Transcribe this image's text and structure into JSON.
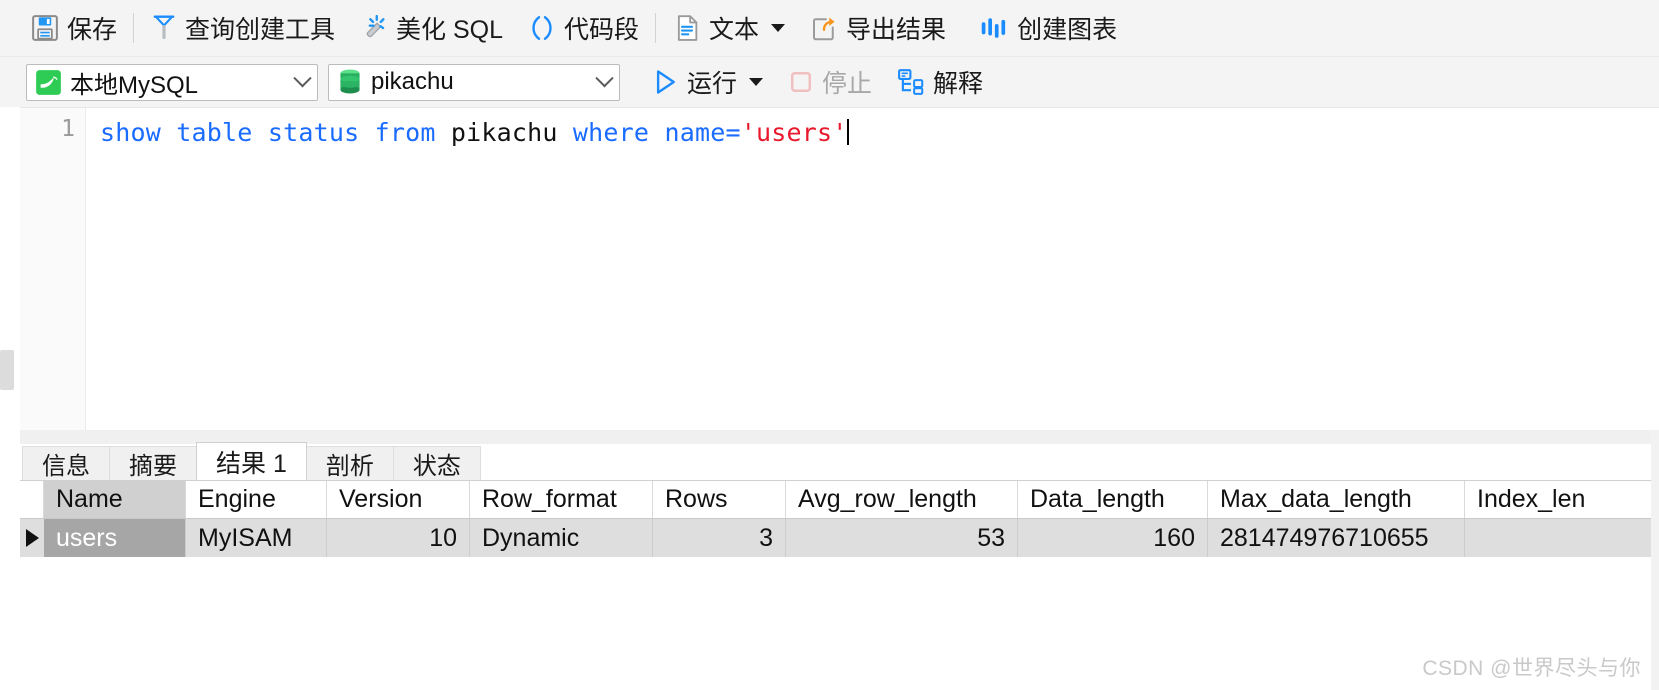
{
  "toolbar_main": {
    "buttons": [
      {
        "id": "save",
        "label": "保存",
        "icon": "floppy-disk-icon",
        "has_caret": false,
        "disabled": false
      },
      {
        "id": "query-builder",
        "label": "查询创建工具",
        "icon": "funnel-icon",
        "has_caret": false,
        "disabled": false
      },
      {
        "id": "beautify-sql",
        "label": "美化 SQL",
        "icon": "magic-wand-icon",
        "has_caret": false,
        "disabled": false
      },
      {
        "id": "snippet",
        "label": "代码段",
        "icon": "parentheses-icon",
        "has_caret": false,
        "disabled": false
      },
      {
        "id": "text-mode",
        "label": "文本",
        "icon": "document-icon",
        "has_caret": true,
        "disabled": false
      },
      {
        "id": "export",
        "label": "导出结果",
        "icon": "export-arrow-icon",
        "has_caret": false,
        "disabled": false
      },
      {
        "id": "chart",
        "label": "创建图表",
        "icon": "bar-chart-icon",
        "has_caret": false,
        "disabled": false
      }
    ]
  },
  "toolbar_query": {
    "connection": {
      "value": "本地MySQL",
      "icon": "mysql-dolphin-icon"
    },
    "database": {
      "value": "pikachu",
      "icon": "database-cylinder-icon"
    },
    "run": {
      "label": "运行",
      "icon": "play-triangle-icon",
      "has_caret": true,
      "disabled": false
    },
    "stop": {
      "label": "停止",
      "icon": "stop-square-icon",
      "disabled": true
    },
    "explain": {
      "label": "解释",
      "icon": "explain-plan-icon",
      "disabled": false
    }
  },
  "editor": {
    "line_number": "1",
    "tokens": [
      {
        "t": "show",
        "c": "kw"
      },
      {
        "t": " ",
        "c": "ws"
      },
      {
        "t": "table",
        "c": "kw"
      },
      {
        "t": " ",
        "c": "ws"
      },
      {
        "t": "status",
        "c": "kw"
      },
      {
        "t": " ",
        "c": "ws"
      },
      {
        "t": "from",
        "c": "kw"
      },
      {
        "t": " ",
        "c": "ws"
      },
      {
        "t": "pikachu",
        "c": "id"
      },
      {
        "t": " ",
        "c": "ws"
      },
      {
        "t": "where",
        "c": "kw"
      },
      {
        "t": " ",
        "c": "ws"
      },
      {
        "t": "name",
        "c": "kw"
      },
      {
        "t": "=",
        "c": "op"
      },
      {
        "t": "'users'",
        "c": "str"
      }
    ],
    "full_text": "show table status from pikachu where name='users'"
  },
  "result_tabs": {
    "items": [
      {
        "id": "info",
        "label": "信息",
        "active": false
      },
      {
        "id": "summary",
        "label": "摘要",
        "active": false
      },
      {
        "id": "result1",
        "label": "结果 1",
        "active": true
      },
      {
        "id": "profile",
        "label": "剖析",
        "active": false
      },
      {
        "id": "status",
        "label": "状态",
        "active": false
      }
    ]
  },
  "grid": {
    "columns": [
      {
        "key": "Name",
        "label": "Name",
        "align": "left",
        "width": "w-name",
        "selected": true
      },
      {
        "key": "Engine",
        "label": "Engine",
        "align": "left",
        "width": "w-eng",
        "selected": false
      },
      {
        "key": "Version",
        "label": "Version",
        "align": "right",
        "width": "w-ver",
        "selected": false
      },
      {
        "key": "Row_format",
        "label": "Row_format",
        "align": "left",
        "width": "w-rf",
        "selected": false
      },
      {
        "key": "Rows",
        "label": "Rows",
        "align": "right",
        "width": "w-rows",
        "selected": false
      },
      {
        "key": "Avg_row_length",
        "label": "Avg_row_length",
        "align": "right",
        "width": "w-avg",
        "selected": false
      },
      {
        "key": "Data_length",
        "label": "Data_length",
        "align": "right",
        "width": "w-data",
        "selected": false
      },
      {
        "key": "Max_data_length",
        "label": "Max_data_length",
        "align": "left",
        "width": "w-max",
        "selected": false
      },
      {
        "key": "Index_len",
        "label": "Index_len",
        "align": "left",
        "width": "w-idx",
        "selected": false
      }
    ],
    "rows": [
      {
        "selected_cell": "Name",
        "cells": {
          "Name": "users",
          "Engine": "MyISAM",
          "Version": "10",
          "Row_format": "Dynamic",
          "Rows": "3",
          "Avg_row_length": "53",
          "Data_length": "160",
          "Max_data_length": "281474976710655",
          "Index_len": ""
        }
      }
    ]
  },
  "watermark": {
    "text": "CSDN @世界尽头与你"
  },
  "colors": {
    "accent_blue": "#1a6bff",
    "string_red": "#e8192c",
    "toolbar_bg": "#f4f4f4",
    "grid_row_bg": "#dedede",
    "selected_cell_bg": "#a6a6a6"
  }
}
